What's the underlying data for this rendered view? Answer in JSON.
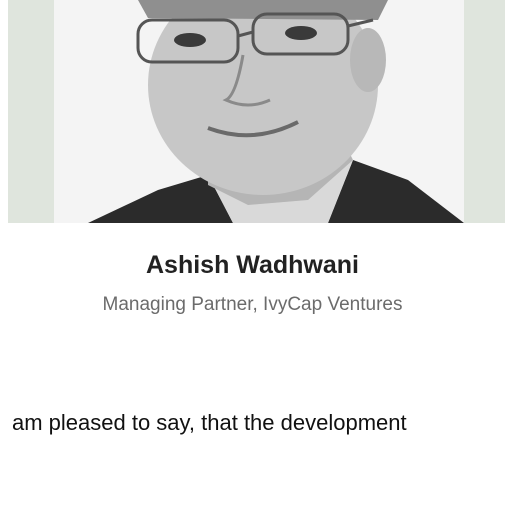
{
  "profile": {
    "name": "Ashish Wadhwani",
    "title": "Managing Partner, IvyCap Ventures",
    "photo_icon": "portrait-photo"
  },
  "testimonial": {
    "text": "am pleased to say, that the development"
  },
  "colors": {
    "photo_background": "#dfe5dd",
    "name_text": "#222222",
    "title_text": "#6b6b6b",
    "body_text": "#111111"
  }
}
